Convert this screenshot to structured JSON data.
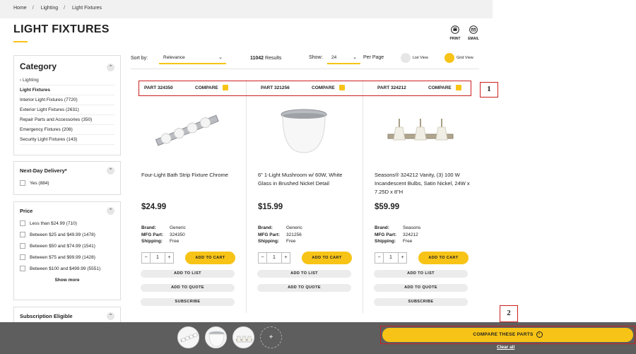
{
  "breadcrumb": [
    "Home",
    "Lighting",
    "Light Fixtures"
  ],
  "page_title": "LIGHT FIXTURES",
  "tools": {
    "print": "PRINT",
    "email": "EMAIL"
  },
  "sidebar": {
    "category": {
      "title": "Category",
      "back": "Lighting",
      "current": "Light Fixtures",
      "items": [
        "Interior Light Fixtures (7720)",
        "Exterior Light Fixtures (2631)",
        "Repair Parts and Accessories (350)",
        "Emergency Fixtures (208)",
        "Security Light Fixtures (143)"
      ]
    },
    "delivery": {
      "title": "Next-Day Delivery*",
      "options": [
        "Yes (884)"
      ]
    },
    "price": {
      "title": "Price",
      "options": [
        "Less than $24.99 (710)",
        "Between $25 and $49.99 (1478)",
        "Between $50 and $74.99 (1541)",
        "Between $75 and $99.99 (1428)",
        "Between $100 and $499.99 (5551)"
      ],
      "show_more": "Show more"
    },
    "subscription": {
      "title": "Subscription Eligible"
    }
  },
  "toolbar": {
    "sort_label": "Sort by:",
    "sort_value": "Relevance",
    "results_count": "11042",
    "results_label": "Results",
    "show_label": "Show:",
    "show_value": "24",
    "per_page": "Per Page",
    "list_view": "List View",
    "grid_view": "Grid View"
  },
  "products": [
    {
      "part": "PART 324350",
      "compare": "COMPARE",
      "name": "Four-Light Bath Strip Fixture Chrome",
      "price": "$24.99",
      "brand": "Generic",
      "mfg": "324350",
      "shipping": "Free",
      "qty": "1"
    },
    {
      "part": "PART 321256",
      "compare": "COMPARE",
      "name": "6\" 1-Light Mushroom w/ 60W, White Glass in Brushed Nickel Detail",
      "price": "$15.99",
      "brand": "Generic",
      "mfg": "321256",
      "shipping": "Free",
      "qty": "1"
    },
    {
      "part": "PART 324212",
      "compare": "COMPARE",
      "name": "Seasons® 324212 Vanity, (3) 100 W Incandescent Bulbs, Satin Nickel, 24W x 7.25D x 8\"H",
      "price": "$59.99",
      "brand": "Seasons",
      "mfg": "324212",
      "shipping": "Free",
      "qty": "1"
    }
  ],
  "spec_labels": {
    "brand": "Brand:",
    "mfg": "MFG Part:",
    "shipping": "Shipping:"
  },
  "buttons": {
    "add_to_cart": "ADD TO CART",
    "add_to_list": "ADD TO LIST",
    "add_to_quote": "ADD TO QUOTE",
    "subscribe": "SUBSCRIBE"
  },
  "callouts": [
    "1",
    "2"
  ],
  "compare_bar": {
    "button": "COMPARE THESE PARTS",
    "clear": "Clear all",
    "add": "+"
  },
  "colors": {
    "accent": "#f7c316",
    "highlight": "#cc1f1f",
    "bar": "#5e5e5e"
  }
}
